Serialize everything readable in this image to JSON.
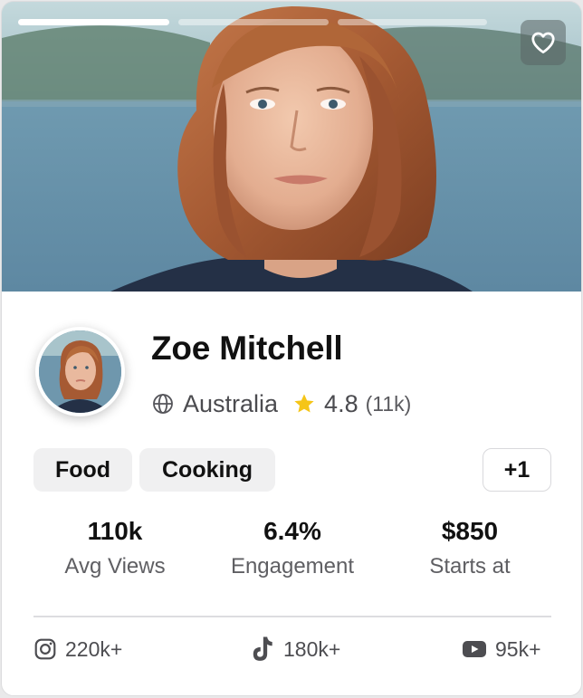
{
  "carousel": {
    "slides": 3,
    "active_slide": 1
  },
  "favorite": {
    "icon": "heart-icon",
    "state": "not-favorited"
  },
  "creator": {
    "name": "Zoe Mitchell",
    "country": "Australia",
    "rating": "4.8",
    "reviews": "(11k)"
  },
  "tags": [
    "Food",
    "Cooking"
  ],
  "more_tags": "+1",
  "stats": [
    {
      "value": "110k",
      "label": "Avg Views"
    },
    {
      "value": "6.4%",
      "label": "Engagement"
    },
    {
      "value": "$850",
      "label": "Starts at"
    }
  ],
  "socials": [
    {
      "platform": "instagram-icon",
      "count": "220k+"
    },
    {
      "platform": "tiktok-icon",
      "count": "180k+"
    },
    {
      "platform": "youtube-icon",
      "count": "95k+"
    }
  ],
  "colors": {
    "star": "#F5C518",
    "text_primary": "#111111",
    "text_secondary": "#4B4B4F"
  }
}
